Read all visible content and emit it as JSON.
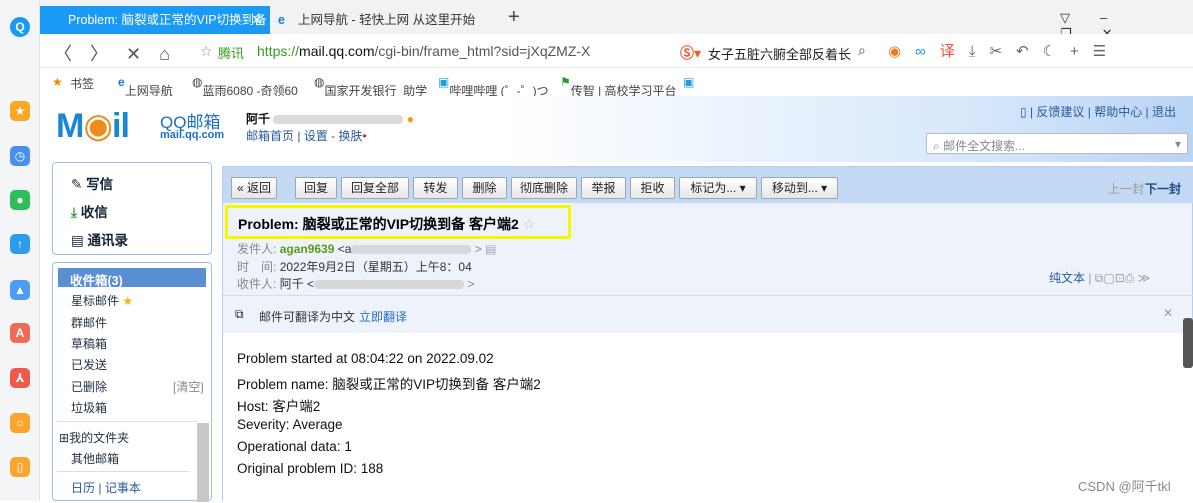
{
  "browser": {
    "tabs": [
      {
        "label": "Problem: 脑裂或正常的VIP切换到备",
        "active": true
      },
      {
        "label": "上网导航 - 轻快上网 从这里开始",
        "active": false
      }
    ],
    "new_tab": "+",
    "address": {
      "site_label": "腾讯",
      "url_green": "https://",
      "url_domain": "mail.qq.com",
      "url_path": "/cgi-bin/frame_html?sid=jXqZMZ-X"
    },
    "search_box": "女子五脏六腑全部反着长",
    "bookmarks": [
      "书签",
      "上网导航",
      "蓝雨6080 -奇领60",
      "国家开发银行_助学",
      "哔哩哔哩 (゜-゜)つ",
      "传智 | 高校学习平台"
    ]
  },
  "mail": {
    "logo_text": "QQ邮箱",
    "logo_domain": "mail.qq.com",
    "user": "阿千",
    "links": [
      "邮箱首页",
      "设置",
      "换肤"
    ],
    "top_links": [
      "反馈建议",
      "帮助中心",
      "退出"
    ],
    "search_placeholder": "邮件全文搜索...",
    "nav": [
      "写信",
      "收信",
      "通讯录"
    ],
    "folders": [
      "收件箱(3)",
      "星标邮件",
      "群邮件",
      "草稿箱",
      "已发送",
      "已删除",
      "垃圾箱"
    ],
    "clear": "[清空]",
    "my_folders": "我的文件夹",
    "other_mail": "其他邮箱",
    "calendar": "日历",
    "notes": "记事本",
    "toolbar": [
      "« 返回",
      "回复",
      "回复全部",
      "转发",
      "删除",
      "彻底删除",
      "举报",
      "拒收",
      "标记为... ▾",
      "移动到... ▾"
    ],
    "prev": "上一封",
    "next": "下一封",
    "subject": "Problem: 脑裂或正常的VIP切换到备 客户端2",
    "from_label": "发件人:",
    "from_name": "agan9639",
    "from_addr": "<a",
    "time_label": "时　间:",
    "time": "2022年9月2日（星期五）上午8：04",
    "to_label": "收件人:",
    "to_name": "阿千",
    "to_addr": "<",
    "plain_text": "纯文本",
    "translate_msg": "邮件可翻译为中文",
    "translate_link": "立即翻译",
    "body": [
      "Problem started at 08:04:22 on 2022.09.02",
      "Problem name: 脑裂或正常的VIP切换到备 客户端2",
      "Host: 客户端2",
      "Severity: Average",
      "Operational data: 1",
      "Original problem ID: 188"
    ]
  },
  "watermark": "CSDN @阿千tkl"
}
